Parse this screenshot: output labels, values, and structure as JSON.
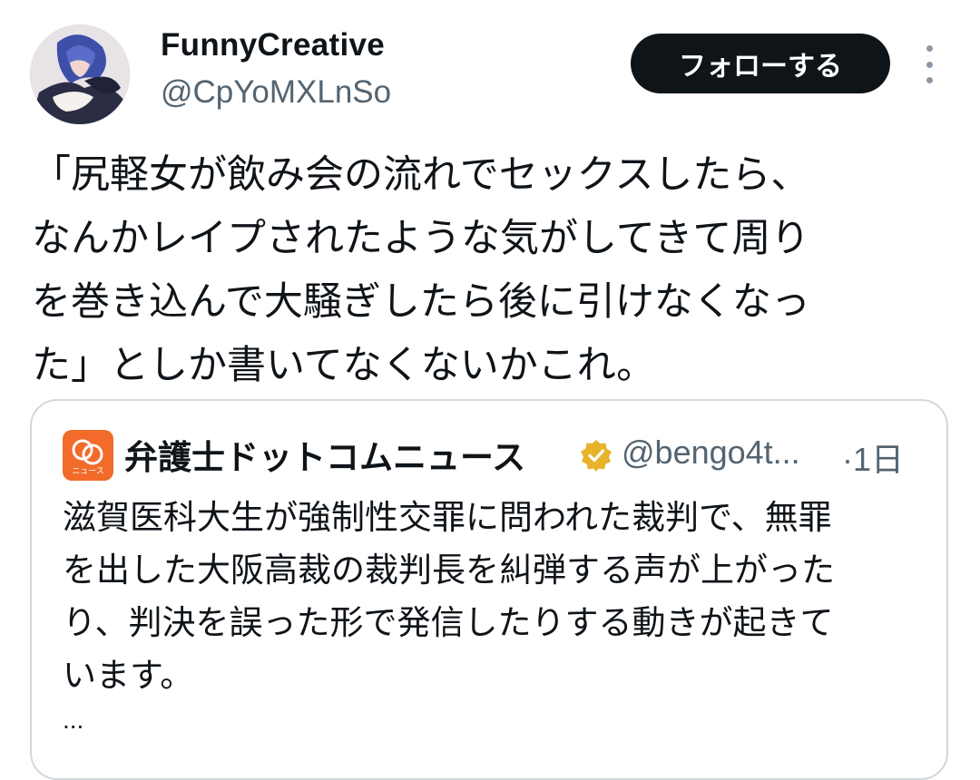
{
  "author": {
    "display_name": "FunnyCreative",
    "handle": "@CpYoMXLnSo",
    "avatar_icon": "anime-character-avatar"
  },
  "follow_button": {
    "label": "フォローする"
  },
  "more_menu": {
    "icon": "more-vertical-icon"
  },
  "tweet": {
    "text": "「尻軽女が飲み会の流れでセックスしたら、\nなんかレイプされたような気がしてきて周り\nを巻き込んで大騒ぎしたら後に引けなくなっ\nた」としか書いてなくないかこれ。"
  },
  "quote": {
    "logo_text": "ニュース",
    "name": "弁護士ドットコムニュース",
    "handle": "@bengo4t...",
    "time": "·1日",
    "text": "滋賀医科大生が強制性交罪に問われた裁判で、無罪\nを出した大阪高裁の裁判長を糾弾する声が上がった\nり、判決を誤った形で発信したりする動きが起きて\nいます。",
    "ellipsis": "...",
    "verified_icon": "gold-verified-badge-icon",
    "brand_color": "#f26b2a"
  },
  "colors": {
    "text_primary": "#0f1419",
    "text_secondary": "#536471",
    "border": "#cfd9de",
    "button_bg": "#0f1419",
    "verified_gold": "#e8b32a"
  }
}
